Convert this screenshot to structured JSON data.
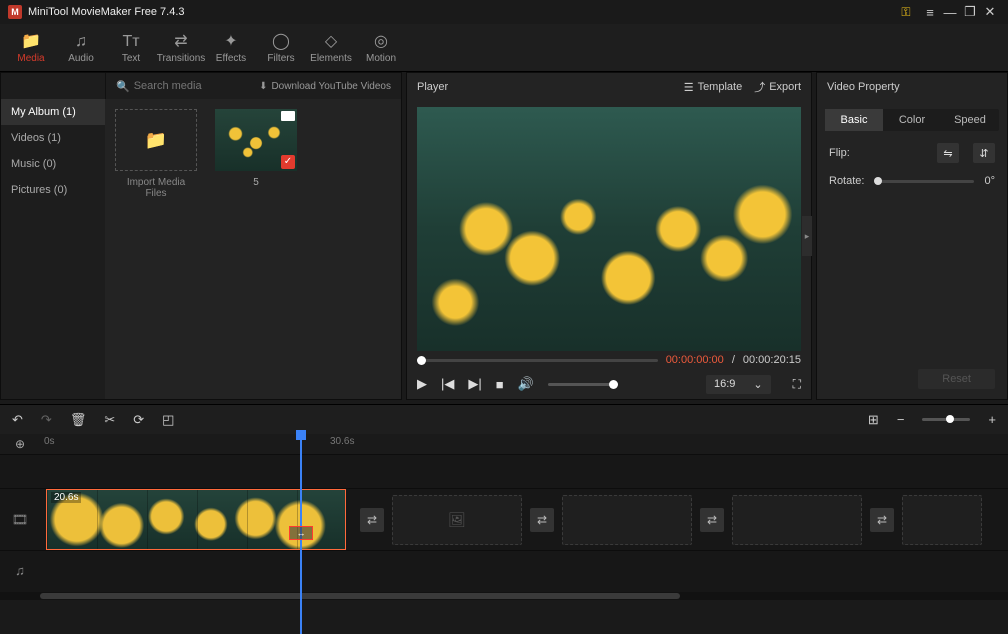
{
  "titlebar": {
    "app_title": "MiniTool MovieMaker Free 7.4.3"
  },
  "toolbar": {
    "media": "Media",
    "audio": "Audio",
    "text": "Text",
    "transitions": "Transitions",
    "effects": "Effects",
    "filters": "Filters",
    "elements": "Elements",
    "motion": "Motion"
  },
  "media": {
    "sidebar": {
      "my_album": "My Album (1)",
      "videos": "Videos (1)",
      "music": "Music (0)",
      "pictures": "Pictures (0)"
    },
    "search_placeholder": "Search media",
    "download_label": "Download YouTube Videos",
    "import_label": "Import Media Files",
    "clip_label": "5"
  },
  "player": {
    "title": "Player",
    "template_label": "Template",
    "export_label": "Export",
    "time_current": "00:00:00:00",
    "time_total": "00:00:20:15",
    "aspect_ratio": "16:9"
  },
  "props": {
    "title": "Video Property",
    "tab_basic": "Basic",
    "tab_color": "Color",
    "tab_speed": "Speed",
    "flip_label": "Flip:",
    "rotate_label": "Rotate:",
    "rotate_value": "0°",
    "reset_label": "Reset"
  },
  "timeline": {
    "ruler_zero": "0s",
    "ruler_mark": "30.6s",
    "clip_duration": "20.6s"
  }
}
